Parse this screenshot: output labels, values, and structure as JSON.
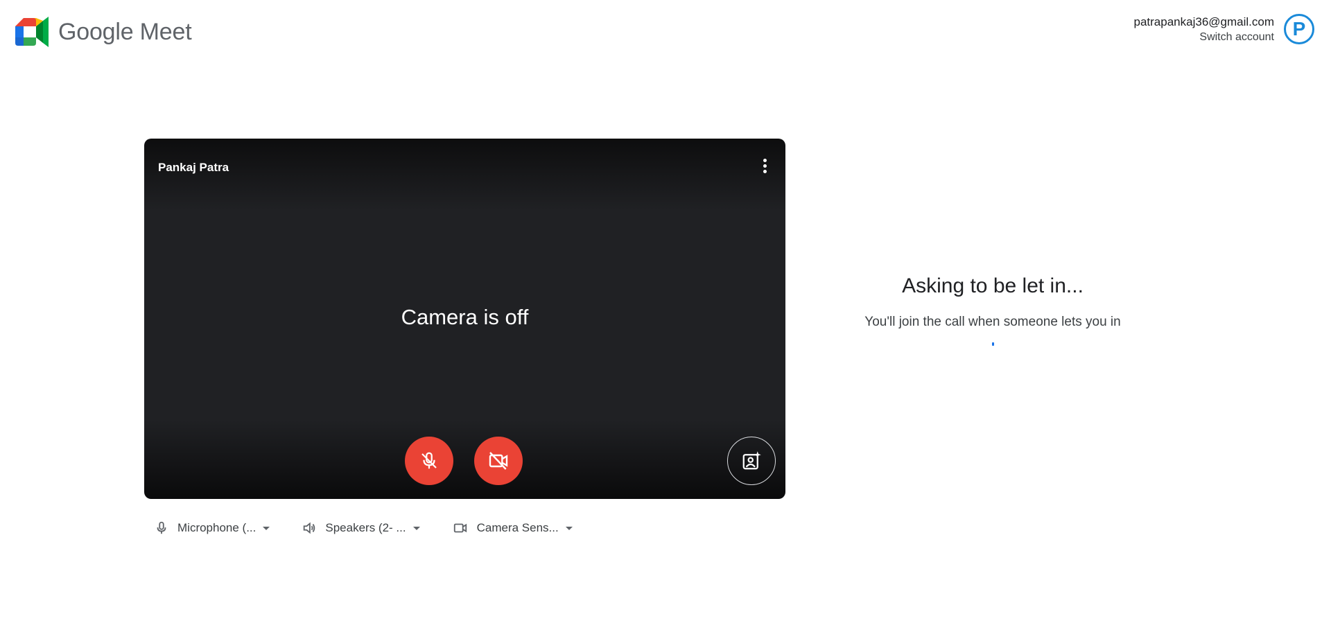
{
  "header": {
    "app_name": "Google Meet",
    "account_email": "patrapankaj36@gmail.com",
    "switch_account_label": "Switch account",
    "avatar_letter": "P"
  },
  "preview": {
    "user_name": "Pankaj Patra",
    "camera_status": "Camera is off",
    "mic_muted": true,
    "camera_disabled": true
  },
  "devices": {
    "microphone": "Microphone (...",
    "speakers": "Speakers (2- ...",
    "camera": "Camera Sens..."
  },
  "status": {
    "title": "Asking to be let in...",
    "subtitle": "You'll join the call when someone lets you in"
  },
  "colors": {
    "accent": "#1a73e8",
    "danger": "#ea4335",
    "preview_bg": "#202124",
    "avatar_ring": "#1a8ad9"
  },
  "icons": [
    "meet-logo-icon",
    "more-vert-icon",
    "mic-off-icon",
    "videocam-off-icon",
    "visual-effects-icon",
    "mic-icon",
    "speaker-icon",
    "videocam-icon",
    "dropdown-caret-icon"
  ]
}
